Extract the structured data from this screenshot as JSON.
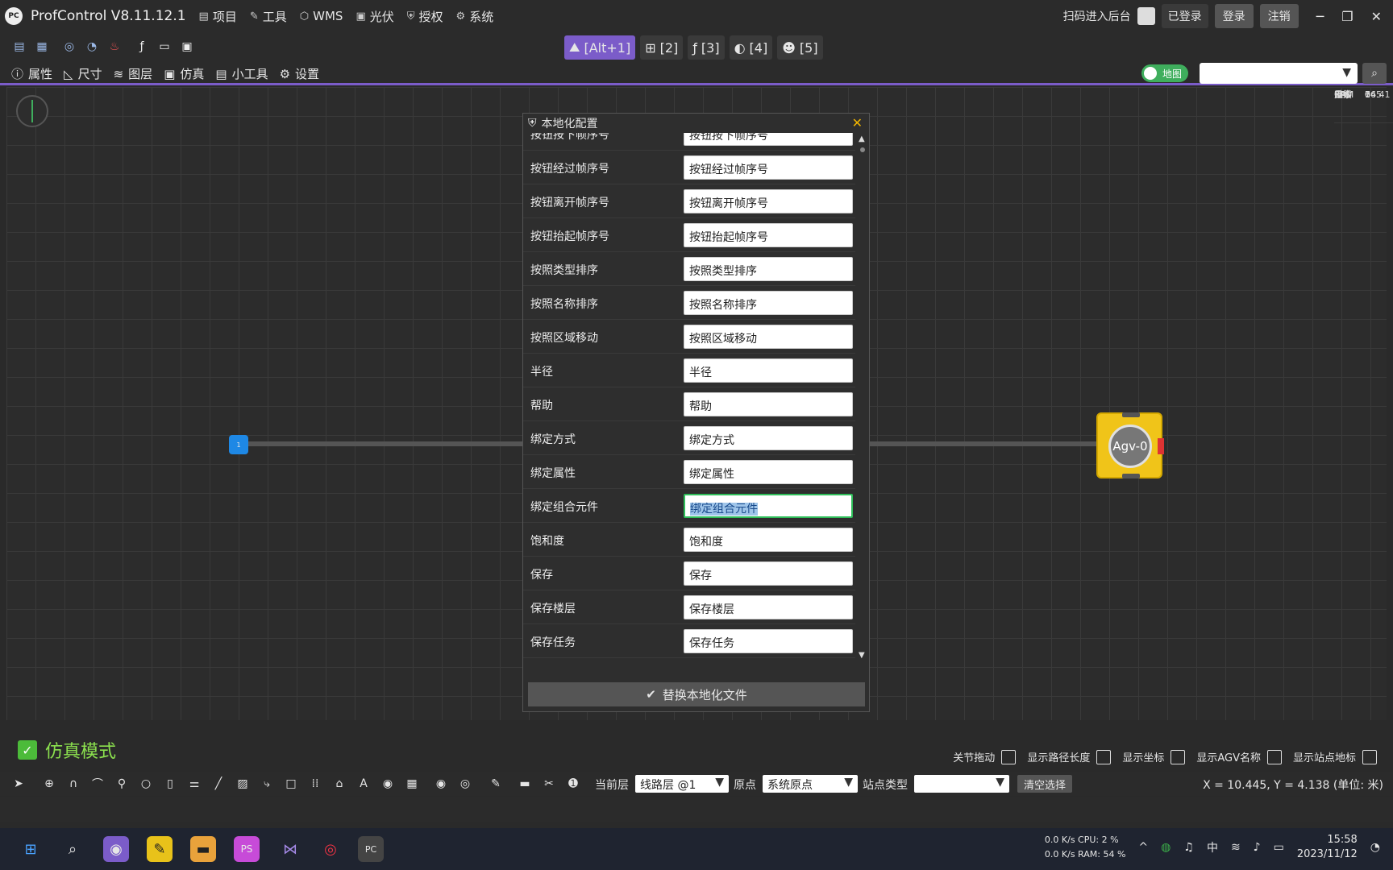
{
  "title": {
    "app": "ProfControl V8.11.12.1",
    "logo": "PC"
  },
  "menu": [
    {
      "label": "项目",
      "icon": "folder-icon"
    },
    {
      "label": "工具",
      "icon": "tool-icon"
    },
    {
      "label": "WMS",
      "icon": "cube-icon"
    },
    {
      "label": "光伏",
      "icon": "solar-icon"
    },
    {
      "label": "授权",
      "icon": "shield-icon"
    },
    {
      "label": "系统",
      "icon": "settings-icon"
    }
  ],
  "account": {
    "scan": "扫码进入后台",
    "logged": "已登录",
    "login": "登录",
    "logout": "注销"
  },
  "view_tabs": [
    {
      "label": "[Alt+1]"
    },
    {
      "label": "[2]"
    },
    {
      "label": "[3]"
    },
    {
      "label": "[4]"
    },
    {
      "label": "[5]"
    }
  ],
  "panel_menu": [
    {
      "label": "属性"
    },
    {
      "label": "尺寸"
    },
    {
      "label": "图层"
    },
    {
      "label": "仿真"
    },
    {
      "label": "小工具"
    },
    {
      "label": "设置"
    }
  ],
  "map_toggle": "地图",
  "stats": [
    {
      "k": "FPS",
      "v": "14.41"
    },
    {
      "k": "CPU",
      "v": "0"
    },
    {
      "k": "RAM",
      "v": "765"
    },
    {
      "k": "重绘",
      "v": "0"
    },
    {
      "k": "元素",
      "v": "6"
    }
  ],
  "canvas": {
    "node_label": "1",
    "agv_label": "Agv-0"
  },
  "dialog": {
    "title": "本地化配置",
    "footer": "替换本地化文件",
    "rows": [
      {
        "label": "按钮按下帧序号",
        "value": "按钮按下帧序号"
      },
      {
        "label": "按钮经过帧序号",
        "value": "按钮经过帧序号"
      },
      {
        "label": "按钮离开帧序号",
        "value": "按钮离开帧序号"
      },
      {
        "label": "按钮抬起帧序号",
        "value": "按钮抬起帧序号"
      },
      {
        "label": "按照类型排序",
        "value": "按照类型排序"
      },
      {
        "label": "按照名称排序",
        "value": "按照名称排序"
      },
      {
        "label": "按照区域移动",
        "value": "按照区域移动"
      },
      {
        "label": "半径",
        "value": "半径"
      },
      {
        "label": "帮助",
        "value": "帮助"
      },
      {
        "label": "绑定方式",
        "value": "绑定方式"
      },
      {
        "label": "绑定属性",
        "value": "绑定属性"
      },
      {
        "label": "绑定组合元件",
        "value": "绑定组合元件"
      },
      {
        "label": "饱和度",
        "value": "饱和度"
      },
      {
        "label": "保存",
        "value": "保存"
      },
      {
        "label": "保存楼层",
        "value": "保存楼层"
      },
      {
        "label": "保存任务",
        "value": "保存任务"
      }
    ]
  },
  "sim_mode": "仿真模式",
  "display_options": [
    {
      "label": "关节拖动"
    },
    {
      "label": "显示路径长度"
    },
    {
      "label": "显示坐标"
    },
    {
      "label": "显示AGV名称"
    },
    {
      "label": "显示站点地标"
    }
  ],
  "bottom": {
    "layer_label": "当前层",
    "layer_value": "线路层 @1",
    "origin_label": "原点",
    "origin_value": "系统原点",
    "site_type_label": "站点类型",
    "site_type_value": "",
    "clear": "清空选择",
    "coords": "X = 10.445, Y = 4.138 (单位: 米)"
  },
  "tray": {
    "net_up": "0.0 K/s CPU:",
    "cpu": "2 %",
    "net_down": "0.0 K/s RAM:",
    "ram": "54 %",
    "ime": "中",
    "time": "15:58",
    "date": "2023/11/12"
  }
}
